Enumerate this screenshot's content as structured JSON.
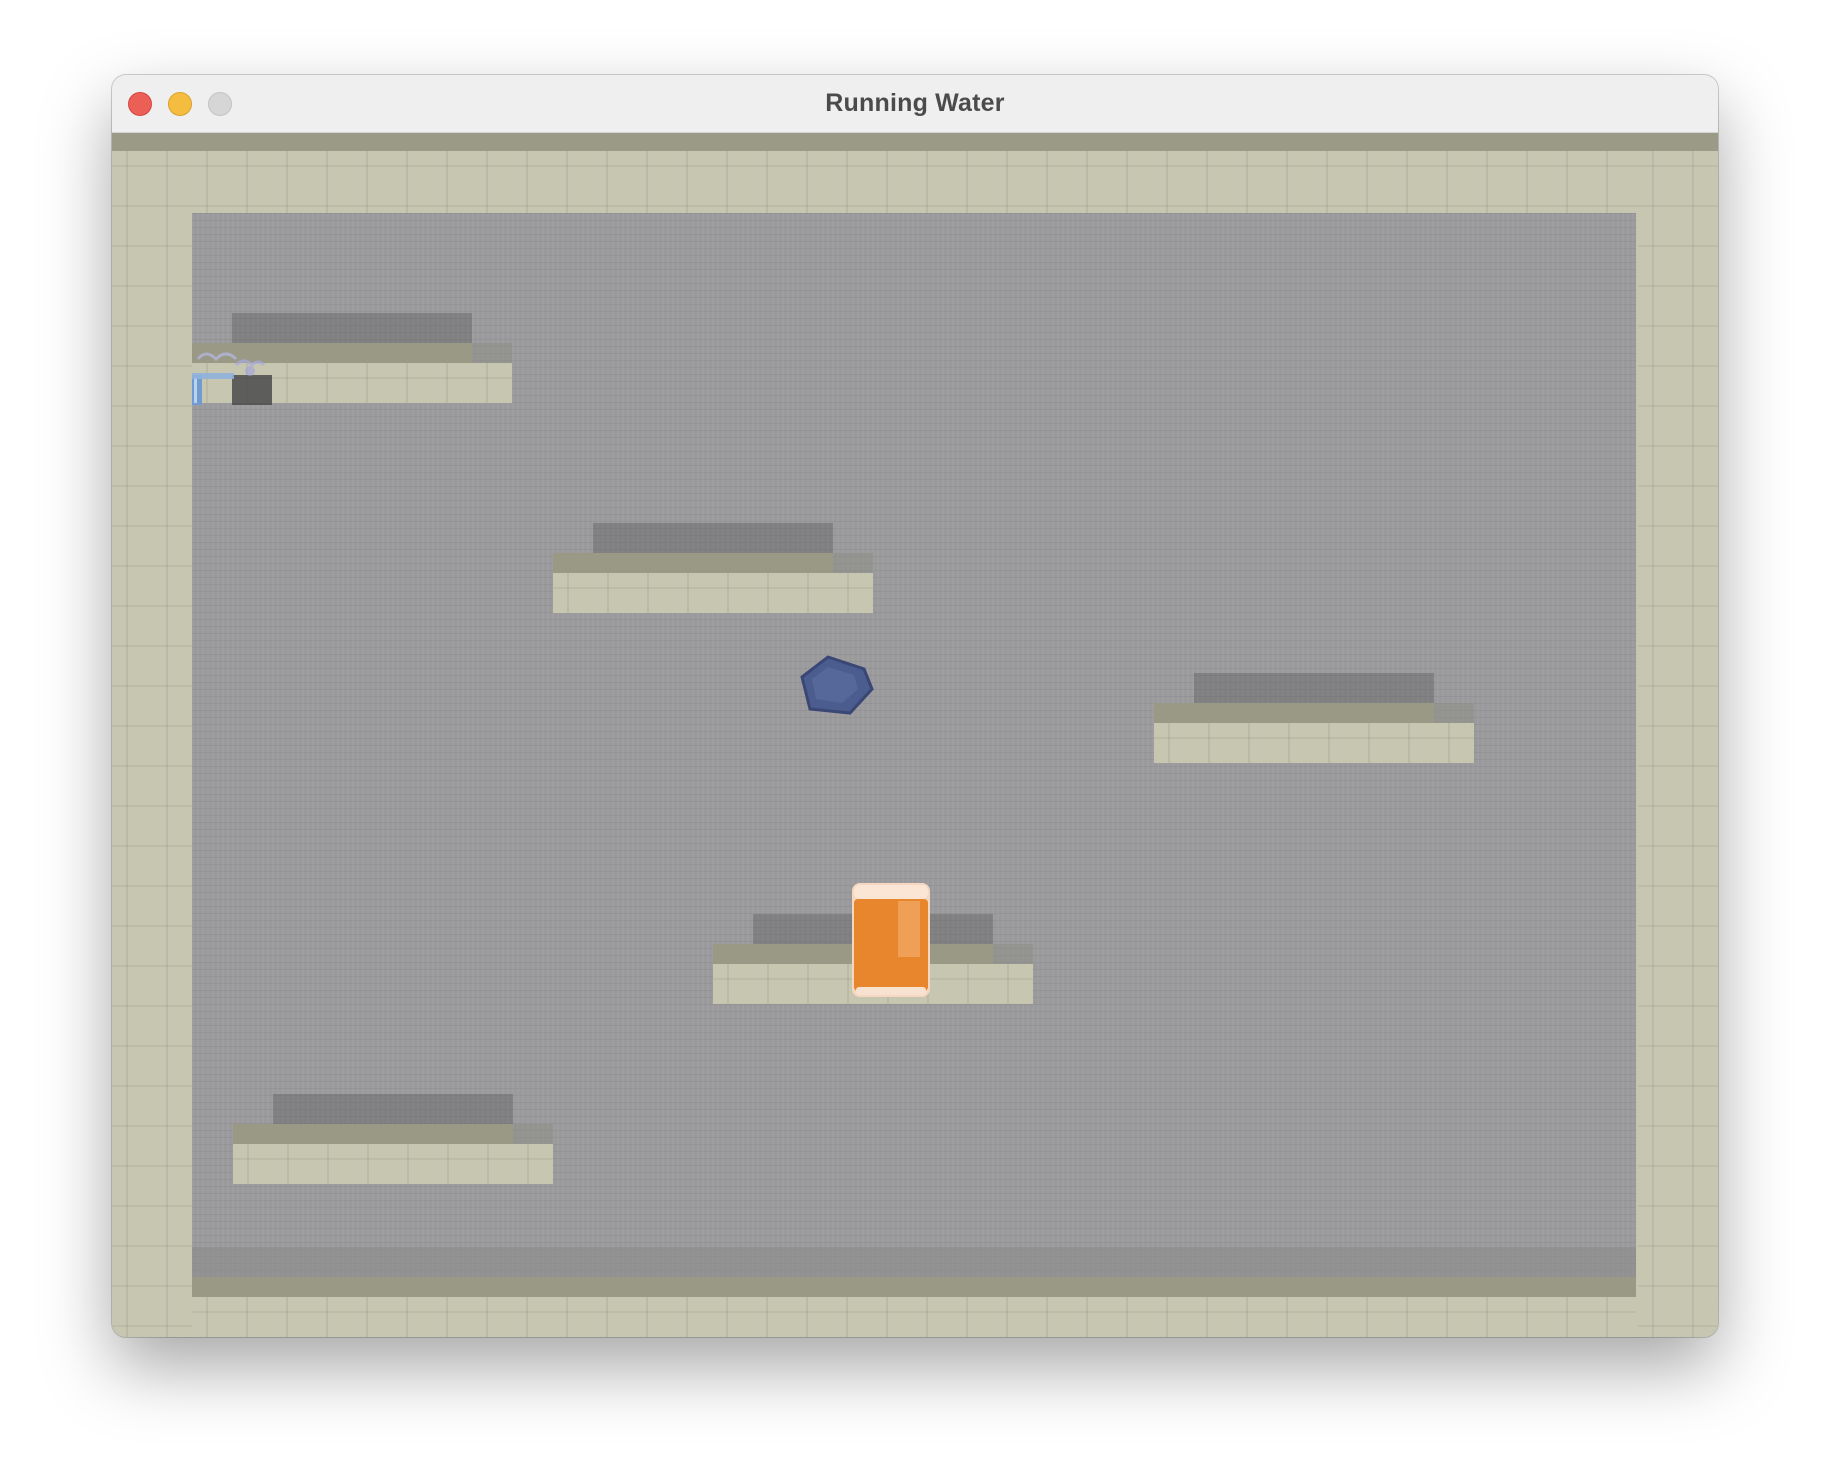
{
  "window": {
    "title": "Running Water"
  },
  "colors": {
    "brick": "#c7c6b0",
    "ledge": "#9a9986",
    "background": "#9a9a9c",
    "water_drop": "#4b5c8e",
    "cup_liquid": "#e8862e"
  },
  "game": {
    "platforms": 5,
    "objects": [
      "faucet-icon",
      "water-drop-icon",
      "cup-icon"
    ]
  }
}
